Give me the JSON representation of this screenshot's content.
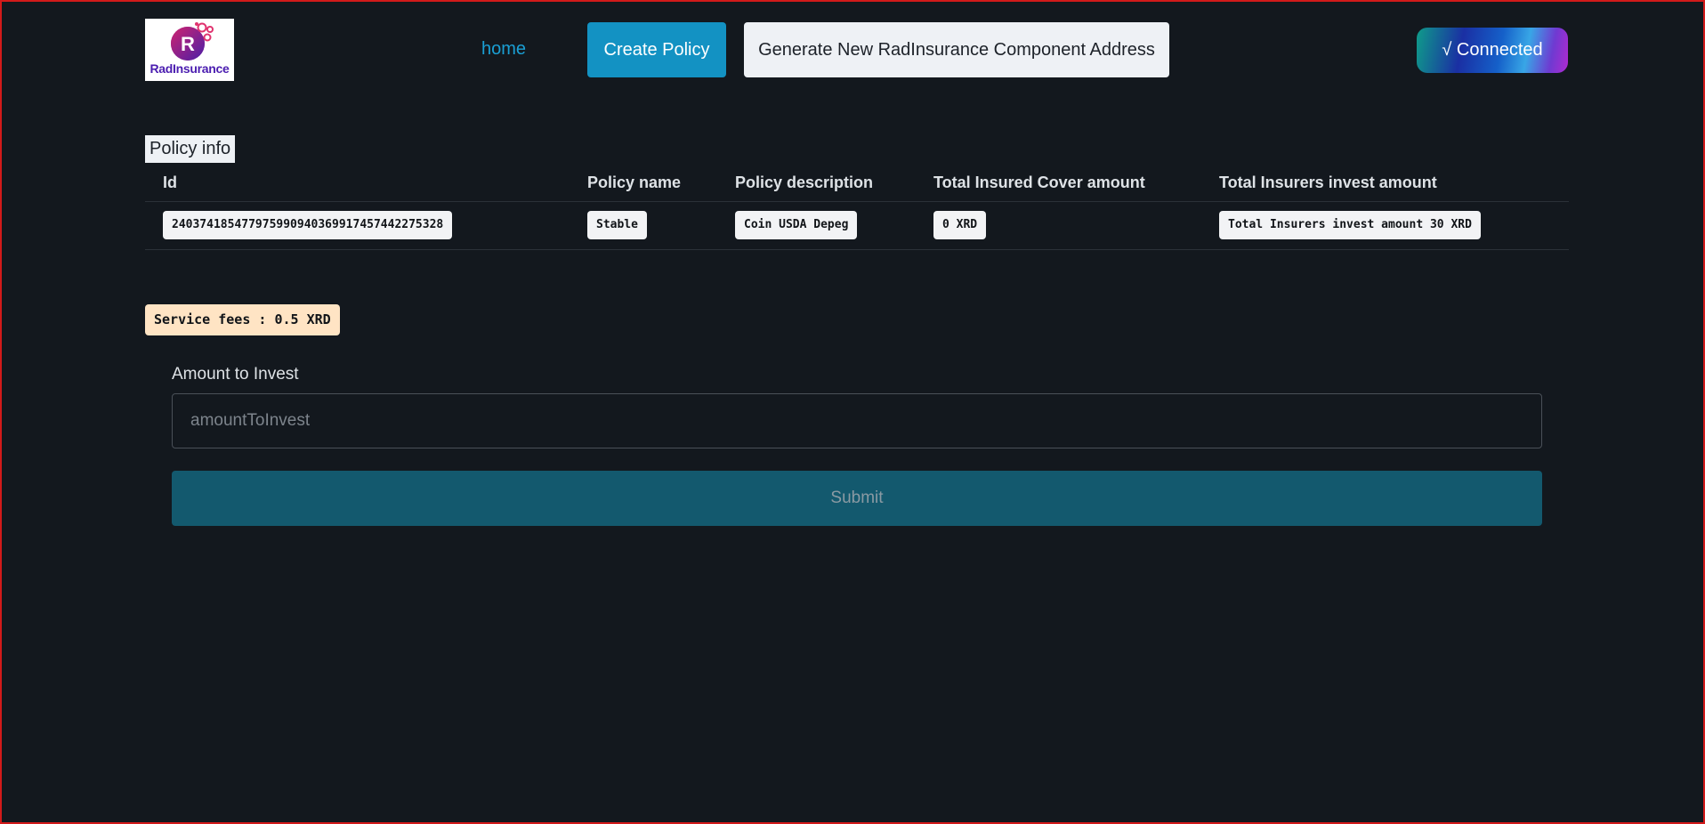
{
  "header": {
    "logo_text": "RadInsurance",
    "nav_home": "home",
    "create_policy": "Create Policy",
    "generate_address": "Generate New RadInsurance Component Address",
    "wallet_status": "√ Connected"
  },
  "policy": {
    "section_title": "Policy info",
    "columns": [
      "Id",
      "Policy name",
      "Policy description",
      "Total Insured Cover amount",
      "Total Insurers invest amount"
    ],
    "row": {
      "id": "24037418547797599094036991745744227532​8",
      "name": "Stable",
      "description": "Coin USDA Depeg",
      "insured_cover": "0 XRD",
      "insurers_invest": "Total Insurers invest amount 30 XRD"
    }
  },
  "service_fee": "Service fees : 0.5 XRD",
  "form": {
    "amount_label": "Amount to Invest",
    "amount_placeholder": "amountToInvest",
    "submit_label": "Submit"
  },
  "colors": {
    "background": "#13181e",
    "accent": "#1392c3",
    "submit": "#13596e",
    "fee_chip": "#ffe4c4"
  }
}
